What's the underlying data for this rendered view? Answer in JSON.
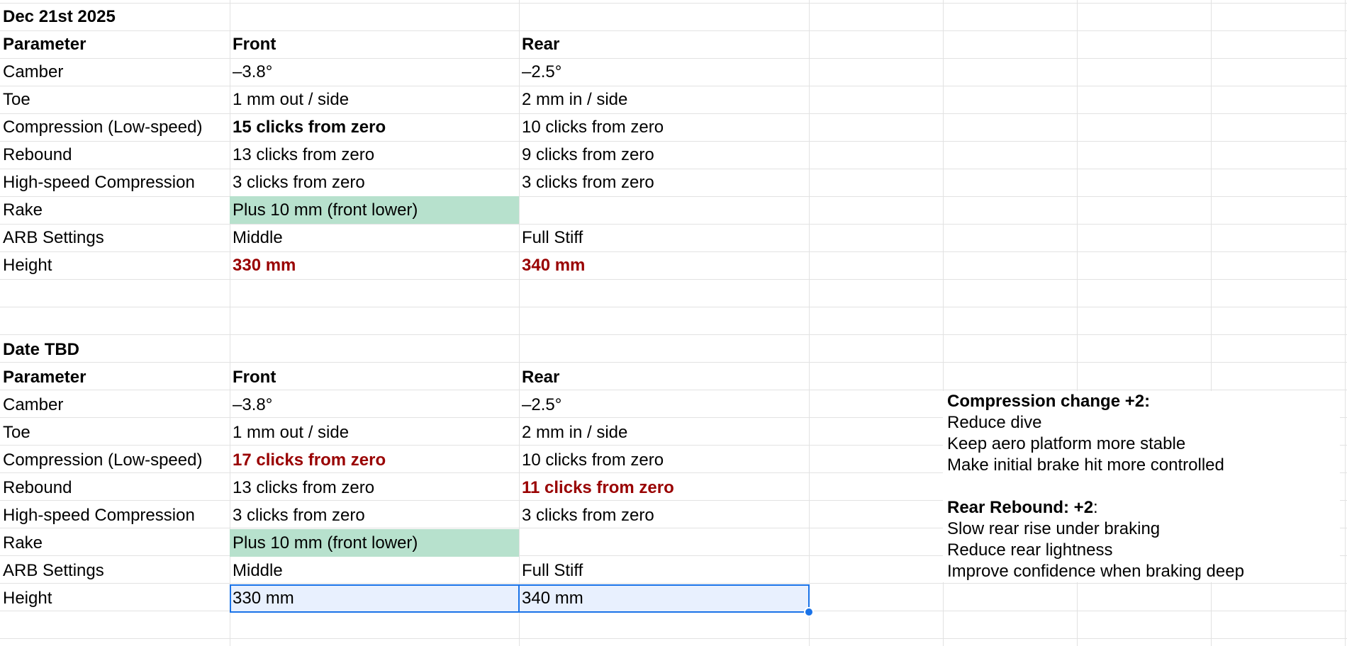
{
  "tables": [
    {
      "date": "Dec 21st 2025",
      "headers": [
        "Parameter",
        "Front",
        "Rear"
      ],
      "rows": [
        [
          "Camber",
          "–3.8°",
          "–2.5°"
        ],
        [
          "Toe",
          "1 mm out / side",
          "2 mm in / side"
        ],
        [
          "Compression (Low-speed)",
          "15 clicks from zero",
          "10 clicks from zero"
        ],
        [
          "Rebound",
          "13 clicks from zero",
          "9 clicks from zero"
        ],
        [
          "High-speed Compression",
          "3 clicks from zero",
          "3 clicks from zero"
        ],
        [
          "Rake",
          "Plus 10 mm (front lower)",
          ""
        ],
        [
          "ARB Settings",
          "Middle",
          "Full Stiff"
        ],
        [
          "Height",
          "330 mm",
          "340 mm"
        ]
      ]
    },
    {
      "date": "Date TBD",
      "headers": [
        "Parameter",
        "Front",
        "Rear"
      ],
      "rows": [
        [
          "Camber",
          "–3.8°",
          "–2.5°"
        ],
        [
          "Toe",
          "1 mm out / side",
          "2 mm in / side"
        ],
        [
          "Compression (Low-speed)",
          "17 clicks from zero",
          "10 clicks from zero"
        ],
        [
          "Rebound",
          "13 clicks from zero",
          "11 clicks from zero"
        ],
        [
          "High-speed Compression",
          "3 clicks from zero",
          "3 clicks from zero"
        ],
        [
          "Rake",
          "Plus 10 mm (front lower)",
          ""
        ],
        [
          "ARB Settings",
          "Middle",
          "Full Stiff"
        ],
        [
          "Height",
          "330 mm",
          "340 mm"
        ]
      ]
    }
  ],
  "note": {
    "heading1": "Compression change +2:",
    "lines1": [
      "Reduce dive",
      "Keep aero platform more stable",
      "Make initial brake hit more controlled"
    ],
    "heading2": "Rear Rebound: +2",
    "heading2_suffix": ":",
    "lines2": [
      "Slow rear rise under braking",
      "Reduce rear lightness",
      "Improve confidence when braking deep"
    ]
  },
  "colors": {
    "highlight_green": "#b7e1cd",
    "changed_red": "#990000",
    "selection_blue": "#1a73e8",
    "selection_fill": "#e8f0fe"
  }
}
